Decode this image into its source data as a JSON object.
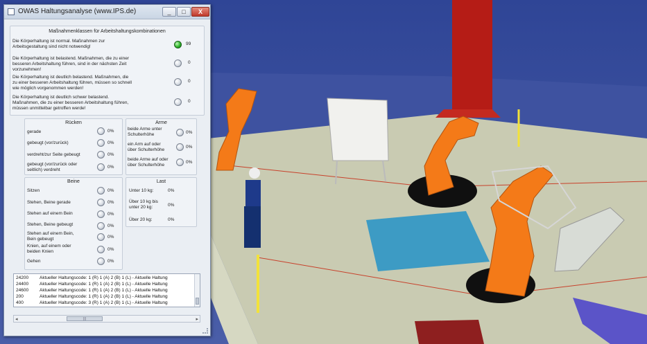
{
  "window": {
    "title": "OWAS Haltungsanalyse (www.IPS.de)",
    "min": "_",
    "max": "□",
    "close": "X"
  },
  "massnahmen": {
    "title": "Maßnahmenklassen für Arbeitshaltungskombinationen",
    "items": [
      {
        "l1": "Die Körperhaltung ist normal. Maßnahmen zur",
        "l2": "Arbeitsgestaltung sind nicht notwendig!",
        "l3": "",
        "value": "99"
      },
      {
        "l1": "Die Körperhaltung ist belastend. Maßnahmen, die zu einer",
        "l2": "besseren Arbeitshaltung führen, sind in der nächsten Zeit",
        "l3": "vorzunehmen!",
        "value": "0"
      },
      {
        "l1": "Die Körperhaltung ist deutlich belastend. Maßnahmen, die",
        "l2": "zu einer besseren Arbeitshaltung führen, müssen so schnell",
        "l3": "wie möglich vorgenommen werden!",
        "value": "0"
      },
      {
        "l1": "Die Körperhaltung ist deutlich schwer belastend.",
        "l2": "Maßnahmen, die zu einer besseren Arbeitshaltung führen,",
        "l3": "müssen unmittelbar getroffen werde!",
        "value": "0"
      }
    ]
  },
  "ruecken": {
    "title": "Rücken",
    "items": [
      {
        "l1": "gerade",
        "l2": "",
        "pct": "0%"
      },
      {
        "l1": "gebeugt (vor/zurück)",
        "l2": "",
        "pct": "0%"
      },
      {
        "l1": "verdreht/zur Seite gebeugt",
        "l2": "",
        "pct": "0%"
      },
      {
        "l1": "gebeugt (vor/zurück oder",
        "l2": "seitlich)  verdreht",
        "pct": "0%"
      }
    ]
  },
  "arme": {
    "title": "Arme",
    "items": [
      {
        "l1": "beide Arme unter",
        "l2": "Schulterhöhe",
        "pct": "0%"
      },
      {
        "l1": "ein Arm auf oder",
        "l2": "über Schulterhöhe",
        "pct": "0%"
      },
      {
        "l1": "beide Arme auf oder",
        "l2": "über Schulterhöhe",
        "pct": "0%"
      }
    ]
  },
  "beine": {
    "title": "Beine",
    "items": [
      {
        "l1": "Sitzen",
        "l2": "",
        "pct": "0%"
      },
      {
        "l1": "Stehen, Beine gerade",
        "l2": "",
        "pct": "0%"
      },
      {
        "l1": "Stehen auf einem Bein",
        "l2": "",
        "pct": "0%"
      },
      {
        "l1": "Stehen, Beine gebeugt",
        "l2": "",
        "pct": "0%"
      },
      {
        "l1": "Stehen auf einem Bein,",
        "l2": "Bein gebeugt",
        "pct": "0%"
      },
      {
        "l1": "Knien, auf einem oder",
        "l2": "beiden Knien",
        "pct": "0%"
      },
      {
        "l1": "Gehen",
        "l2": "",
        "pct": "0%"
      }
    ]
  },
  "last": {
    "title": "Last",
    "items": [
      {
        "l1": "Unter 10 kg:",
        "l2": "",
        "pct": "0%"
      },
      {
        "l1": "Über 10 kg bis",
        "l2": "unter 20 kg:",
        "pct": "0%"
      },
      {
        "l1": "Über 20 kg:",
        "l2": "",
        "pct": "0%"
      }
    ]
  },
  "log": [
    {
      "n": "24200",
      "t": "Aktueller Haltungscode: 1 (R) 1 (A) 2 (B) 1 (L) - Aktuelle Haltung"
    },
    {
      "n": "24400",
      "t": "Aktueller Haltungscode: 1 (R) 1 (A) 2 (B) 1 (L) - Aktuelle Haltung"
    },
    {
      "n": "24600",
      "t": "Aktueller Haltungscode: 1 (R) 1 (A) 2 (B) 1 (L) - Aktuelle Haltung"
    },
    {
      "n": "200",
      "t": "Aktueller Haltungscode: 1 (R) 1 (A) 2 (B) 1 (L) - Aktuelle Haltung"
    },
    {
      "n": "400",
      "t": "Aktueller Haltungscode: 3 (R) 1 (A) 2 (B) 1 (L) - Aktuelle Haltung"
    }
  ],
  "hscroll": {
    "thumb": "|||"
  }
}
